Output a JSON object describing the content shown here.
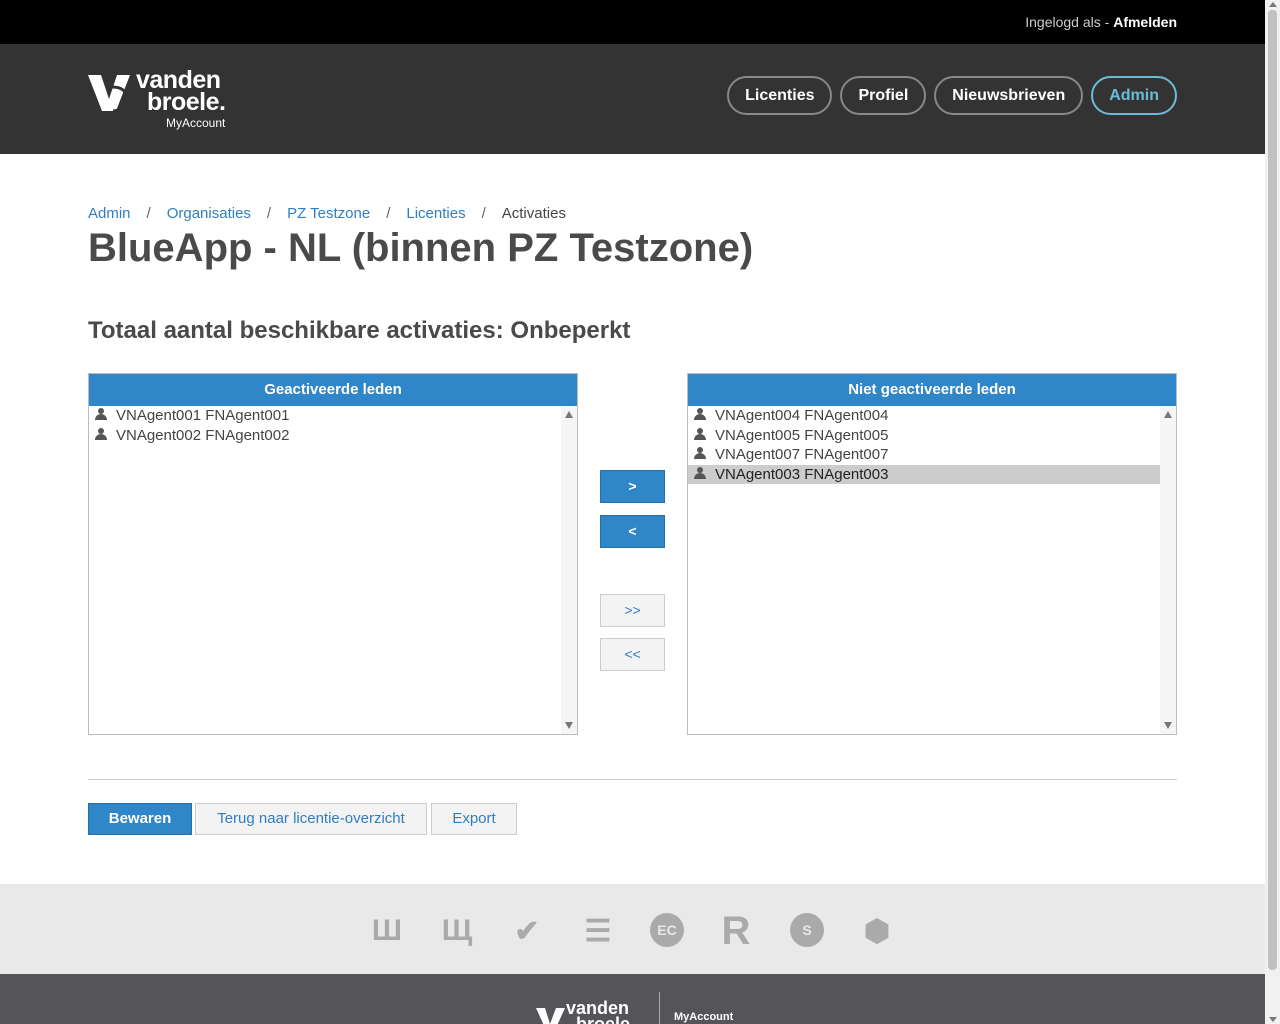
{
  "topbar": {
    "logged_in_as": "Ingelogd als - ",
    "logout": "Afmelden"
  },
  "logo": {
    "line1": "vanden",
    "line2": "broele.",
    "line3": "MyAccount"
  },
  "nav": [
    {
      "label": "Licenties",
      "active": false
    },
    {
      "label": "Profiel",
      "active": false
    },
    {
      "label": "Nieuwsbrieven",
      "active": false
    },
    {
      "label": "Admin",
      "active": true
    }
  ],
  "breadcrumb": [
    "Admin",
    "Organisaties",
    "PZ Testzone",
    "Licenties",
    "Activaties"
  ],
  "page_title": "BlueApp - NL (binnen PZ Testzone)",
  "total": "Totaal aantal beschikbare activaties: Onbeperkt",
  "activated": {
    "header": "Geactiveerde leden",
    "items": [
      "VNAgent001 FNAgent001",
      "VNAgent002 FNAgent002"
    ]
  },
  "not_activated": {
    "header": "Niet geactiveerde leden",
    "items": [
      "VNAgent004 FNAgent004",
      "VNAgent005 FNAgent005",
      "VNAgent007 FNAgent007",
      "VNAgent003 FNAgent003"
    ],
    "selected_index": 3
  },
  "move": {
    "right": ">",
    "left": "<",
    "all_right": ">>",
    "all_left": "<<"
  },
  "actions": {
    "save": "Bewaren",
    "back": "Terug naar licentie-overzicht",
    "export": "Export"
  },
  "partners": [
    "Ш",
    "Щ",
    "✔",
    "☰",
    "EC",
    "R",
    "S",
    "⬢"
  ],
  "footer": {
    "logo1": "vanden",
    "logo2": "broele",
    "myaccount": "MyAccount"
  },
  "colors": {
    "accent": "#2f86c9",
    "admin_active": "#6bbcd8",
    "header_bg": "#333333",
    "topbar_bg": "#000000"
  }
}
